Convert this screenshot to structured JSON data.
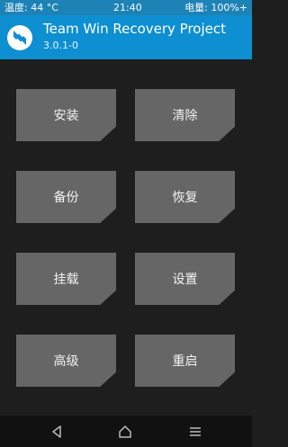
{
  "status_bar": {
    "temperature": "温度: 44 °C",
    "time": "21:40",
    "battery": "电量: 100%+"
  },
  "header": {
    "title": "Team Win Recovery Project",
    "version": "3.0.1-0",
    "logo_icon": "twrp-logo-icon"
  },
  "menu": {
    "install": "安装",
    "wipe": "清除",
    "backup": "备份",
    "restore": "恢复",
    "mount": "挂载",
    "settings": "设置",
    "advanced": "高级",
    "reboot": "重启"
  },
  "nav": {
    "back_icon": "back-icon",
    "home_icon": "home-icon",
    "menu_icon": "menu-icon"
  },
  "colors": {
    "header": "#0e8fd1",
    "status_bar": "#1d82b6",
    "background": "#1e1e1e",
    "tile": "#666666",
    "nav_bar": "#111111"
  }
}
